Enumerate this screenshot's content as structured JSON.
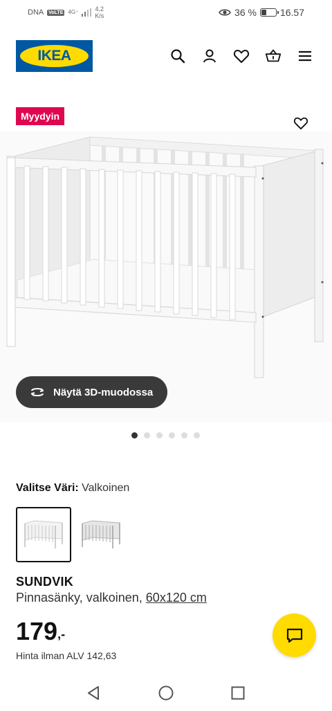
{
  "status_bar": {
    "carrier": "DNA",
    "volte": "VoLTE",
    "network": "4G⁺",
    "speed_value": "4,2",
    "speed_unit": "K/s",
    "battery_percent_text": "36 %",
    "battery_level": 0.36,
    "time": "16.57"
  },
  "header": {
    "logo_text": "IKEA",
    "icons": [
      "search-icon",
      "profile-icon",
      "heart-icon",
      "basket-icon",
      "menu-icon"
    ]
  },
  "product": {
    "badge": "Myydyin",
    "view_3d_label": "Näytä 3D-muodossa",
    "carousel": {
      "count": 6,
      "active_index": 0
    },
    "color_label": "Valitse Väri:",
    "color_value": "Valkoinen",
    "name": "SUNDVIK",
    "description": "Pinnasänky, valkoinen,",
    "size": "60x120 cm",
    "price_main": "179",
    "price_suffix": ",-",
    "price_vat": "Hinta ilman ALV 142,63"
  },
  "colors": {
    "badge_bg": "#e00751",
    "ikea_blue": "#0058a3",
    "ikea_yellow": "#ffdb00"
  }
}
